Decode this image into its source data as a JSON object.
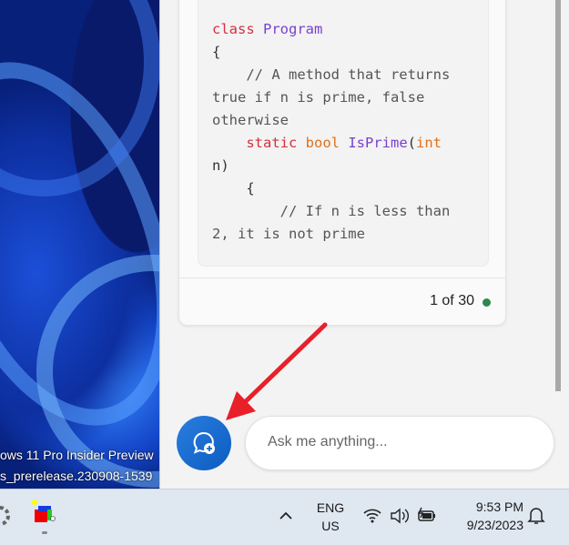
{
  "desktop": {
    "watermark_line1": "ows 11 Pro Insider Preview",
    "watermark_line2": "s_prerelease.230908-1539"
  },
  "chat": {
    "code_lines": [
      [
        {
          "t": "class ",
          "c": "kw"
        },
        {
          "t": "Program",
          "c": "ty"
        }
      ],
      [
        {
          "t": "{",
          "c": ""
        }
      ],
      [
        {
          "t": "    // A method that returns",
          "c": "cm"
        }
      ],
      [
        {
          "t": "true if n is prime, false",
          "c": "cm"
        }
      ],
      [
        {
          "t": "otherwise",
          "c": "cm"
        }
      ],
      [
        {
          "t": "    static ",
          "c": "kw"
        },
        {
          "t": "bool ",
          "c": "ki"
        },
        {
          "t": "IsPrime",
          "c": "ty"
        },
        {
          "t": "(",
          "c": ""
        },
        {
          "t": "int",
          "c": "ki"
        }
      ],
      [
        {
          "t": "n)",
          "c": ""
        }
      ],
      [
        {
          "t": "    {",
          "c": ""
        }
      ],
      [
        {
          "t": "        // If n is less than",
          "c": "cm"
        }
      ],
      [
        {
          "t": "2, it is not prime",
          "c": "cm"
        }
      ]
    ],
    "response_count": "1 of 30",
    "status_color": "#2a8a4a",
    "input_placeholder": "Ask me anything...",
    "new_topic_icon": "chat-bubble-plus-icon"
  },
  "taskbar": {
    "lang_line1": "ENG",
    "lang_line2": "US",
    "time": "9:53 PM",
    "date": "9/23/2023"
  }
}
